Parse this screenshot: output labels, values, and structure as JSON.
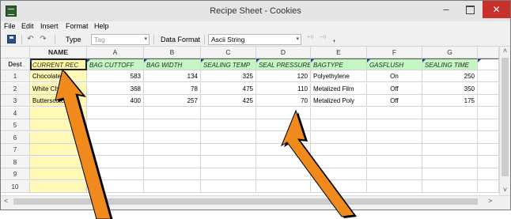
{
  "window": {
    "title": "Recipe Sheet - Cookies",
    "minimize": "–",
    "close": "✕"
  },
  "menu": [
    "File",
    "Edit",
    "Insert",
    "Format",
    "Help"
  ],
  "toolbar": {
    "type_label": "Type",
    "type_value": "Tag",
    "data_format_label": "Data Format",
    "data_format_value": "Ascii String",
    "icons": [
      "save-icon",
      "undo-icon",
      "redo-icon",
      "inc-decimal-icon",
      "dec-decimal-icon",
      "comma-icon"
    ],
    "undo_glyph": "↶",
    "redo_glyph": "↷",
    "inc_glyph": "⁺⁰",
    "dec_glyph": "⁻⁰",
    "comma_glyph": ","
  },
  "grid": {
    "corner": "",
    "name_header": "NAME",
    "column_letters": [
      "A",
      "B",
      "C",
      "D",
      "E",
      "F",
      "G"
    ],
    "dest_label": "Dest",
    "fields": [
      "CURRENT REC",
      "BAG CUTTOFF",
      "BAG WIDTH",
      "SEALING TEMP",
      "SEAL PRESSURE",
      "BAGTYPE",
      "GASFLUSH",
      "SEALING TIME"
    ],
    "row_numbers": [
      "1",
      "2",
      "3",
      "4",
      "5",
      "6",
      "7",
      "8",
      "9",
      "10"
    ],
    "rows": [
      [
        "Chocolate",
        "583",
        "134",
        "325",
        "120",
        "Polyethylene",
        "On",
        "250"
      ],
      [
        "White Ch",
        "368",
        "78",
        "475",
        "110",
        "Metalized Film",
        "Off",
        "350"
      ],
      [
        "Butterscotc",
        "400",
        "257",
        "425",
        "70",
        "Metalized Poly",
        "Off",
        "175"
      ]
    ]
  },
  "scroll": {
    "up": "˄",
    "down": "˅",
    "left": "<",
    "right": ">"
  },
  "colors": {
    "field_row": "#c3f6c3",
    "name_column": "#fff9b5",
    "annotation_arrow": "#f08a1c",
    "close_button": "#c9302c"
  }
}
